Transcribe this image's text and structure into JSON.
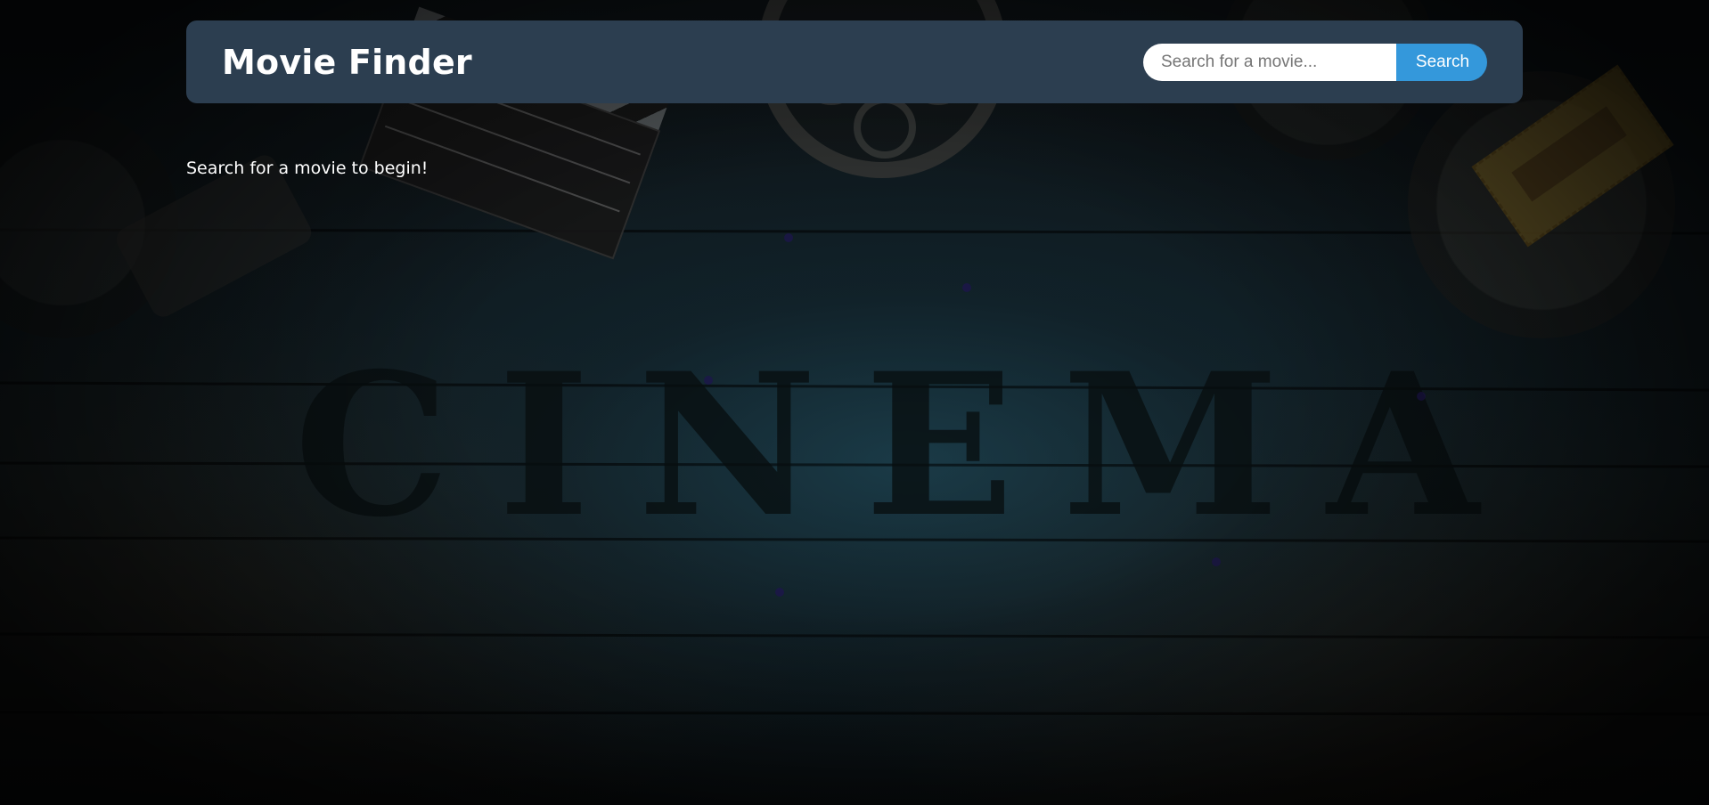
{
  "header": {
    "title": "Movie Finder",
    "search_placeholder": "Search for a movie...",
    "search_value": "",
    "search_button_label": "Search"
  },
  "main": {
    "empty_message": "Search for a movie to begin!"
  },
  "background": {
    "letters": [
      "C",
      "I",
      "N",
      "E",
      "M",
      "A"
    ]
  },
  "colors": {
    "header_bg": "#2c3e50",
    "accent": "#3498db",
    "text": "#ffffff"
  }
}
